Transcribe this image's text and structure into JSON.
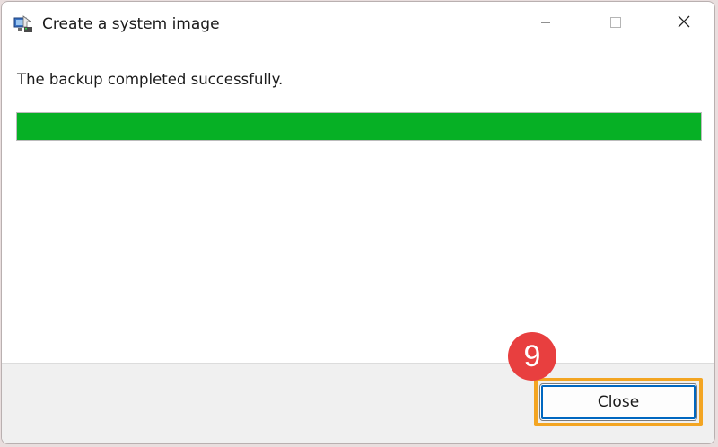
{
  "window": {
    "title": "Create a system image",
    "icon": "system-image-app-icon"
  },
  "caption_buttons": {
    "minimize": "minimize-icon",
    "maximize": "maximize-icon",
    "close": "close-icon"
  },
  "content": {
    "message": "The backup completed successfully.",
    "progress": {
      "value_percent": 100,
      "color": "#06b025"
    }
  },
  "footer": {
    "close_label": "Close"
  },
  "annotation": {
    "step_number": "9",
    "badge_color": "#e83f3f",
    "highlight_color": "#f3a522"
  }
}
